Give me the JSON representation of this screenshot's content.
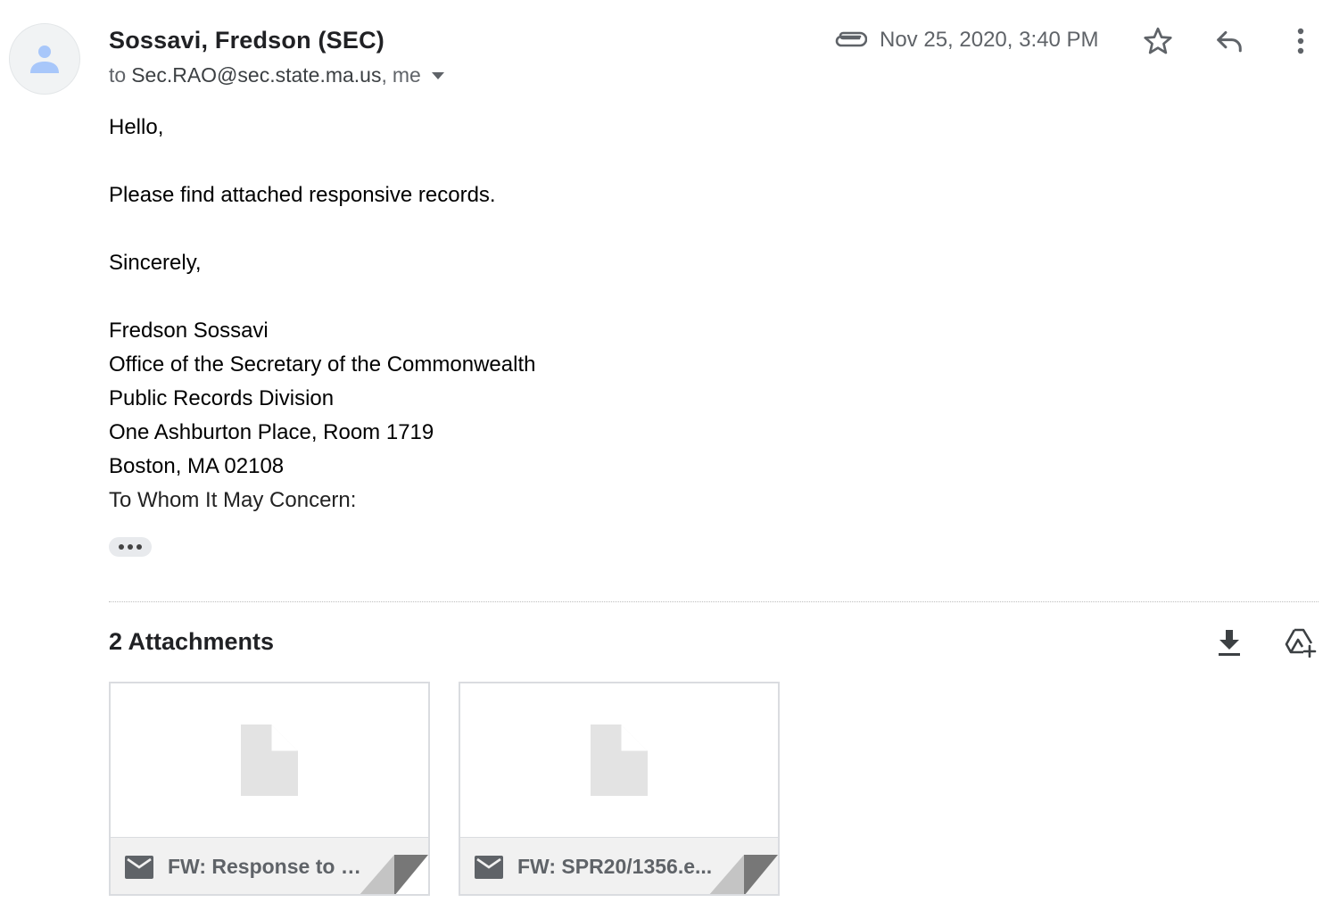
{
  "header": {
    "sender": "Sossavi, Fredson (SEC)",
    "to_label": "to",
    "recipient_primary": "Sec.RAO@sec.state.ma.us",
    "recipient_sep": ",",
    "recipient_me": "me",
    "date": "Nov 25, 2020, 3:40 PM"
  },
  "body": {
    "greeting": "Hello,",
    "message": "Please find attached responsive records.",
    "closing": "Sincerely,",
    "signature": [
      "Fredson Sossavi",
      "Office of the Secretary of the Commonwealth",
      "Public Records Division",
      "One Ashburton Place, Room 1719",
      "Boston, MA 02108",
      "To Whom It May Concern:"
    ]
  },
  "attachments": {
    "title": "2 Attachments",
    "items": [
      {
        "name": "FW: Response to S...",
        "icon": "mail-icon"
      },
      {
        "name": "FW: SPR20/1356.e...",
        "icon": "mail-icon"
      }
    ]
  },
  "icons": {
    "avatar": "person-icon",
    "attachment": "paperclip-icon",
    "star": "star-icon",
    "reply": "reply-icon",
    "more": "more-vert-icon",
    "download": "download-icon",
    "drive": "add-to-drive-icon"
  },
  "colors": {
    "avatar_person": "#a8c7fa",
    "text_secondary": "#5f6368",
    "icon": "#5f6368"
  }
}
